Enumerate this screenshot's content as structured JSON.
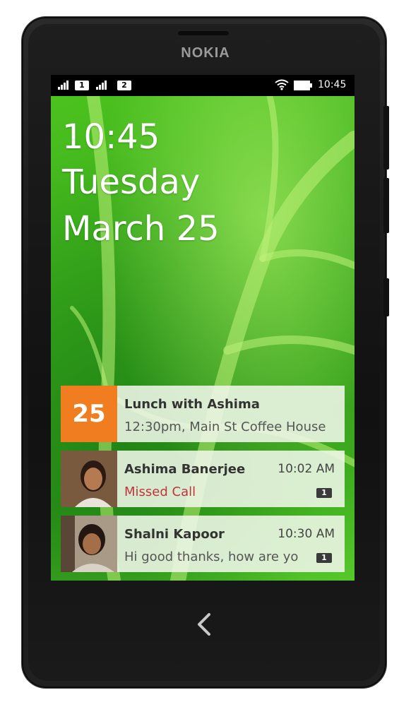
{
  "device": {
    "brand": "NOKIA"
  },
  "status_bar": {
    "sim1": "1",
    "sim2": "2",
    "clock": "10:45"
  },
  "lockscreen": {
    "time": "10:45",
    "day": "Tuesday",
    "date": "March 25"
  },
  "notifications": [
    {
      "kind": "calendar",
      "day_number": "25",
      "title": "Lunch with Ashima",
      "subtitle": "12:30pm, Main St Coffee House"
    },
    {
      "kind": "call",
      "title": "Ashima Banerjee",
      "time": "10:02 AM",
      "subtitle": "Missed Call",
      "badge": "1"
    },
    {
      "kind": "message",
      "title": "Shalni Kapoor",
      "time": "10:30 AM",
      "subtitle": "Hi good thanks, how are yo",
      "badge": "1"
    }
  ],
  "colors": {
    "calendar_accent": "#f07e20",
    "missed_call": "#c0343c",
    "wallpaper_green": "#3aad1b"
  },
  "nav": {
    "back_icon": "chevron-left-icon"
  }
}
